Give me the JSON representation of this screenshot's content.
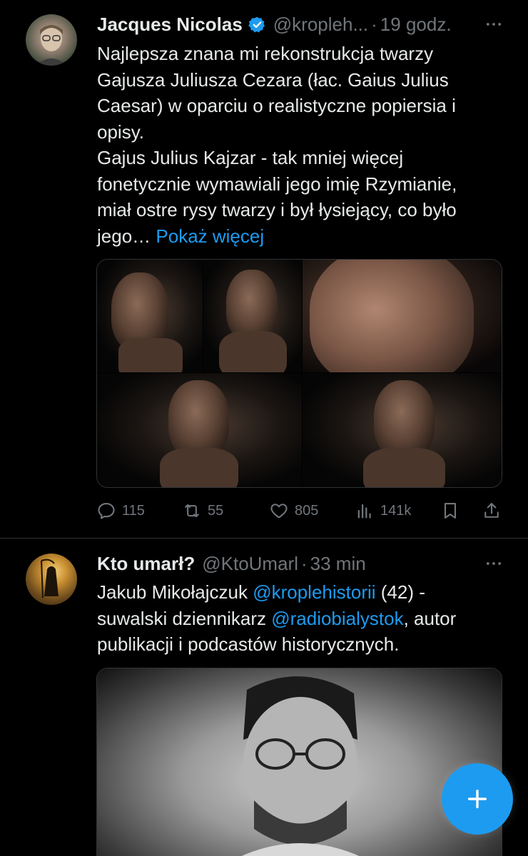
{
  "tweets": [
    {
      "author_name": "Jacques Nicolas",
      "handle": "@kropleh...",
      "separator": "·",
      "time": "19 godz.",
      "text_lines": [
        "Najlepsza  znana mi rekonstrukcja twarzy",
        "Gajusza Juliusza Cezara (łac. Gaius Julius",
        "Caesar) w oparciu o realistyczne popiersia i",
        "opisy.",
        "Gajus Julius Kajzar - tak mniej więcej",
        "fonetycznie wymawiali jego imię Rzymianie,",
        "miał ostre rysy twarzy i był łysiejący, co było",
        "jego…"
      ],
      "show_more": "Pokaż więcej",
      "stats": {
        "replies": "115",
        "retweets": "55",
        "likes": "805",
        "views": "141k"
      }
    },
    {
      "author_name": "Kto umarł?",
      "handle": "@KtoUmarl",
      "separator": "·",
      "time": "33 min",
      "text": {
        "line1_a": "Jakub Mikołajczuk ",
        "mention1": "@kroplehistorii",
        "line1_b": " (42) -",
        "line2_a": "suwalski dziennikarz ",
        "mention2": "@radiobialystok",
        "line2_b": ", autor",
        "line3": "publikacji i podcastów historycznych."
      }
    }
  ],
  "icons": {
    "verified": "verified-badge-icon",
    "more": "more-dots-icon",
    "reply": "reply-icon",
    "retweet": "retweet-icon",
    "like": "heart-icon",
    "views": "views-icon",
    "bookmark": "bookmark-icon",
    "share": "share-icon",
    "compose": "plus-icon"
  },
  "colors": {
    "background": "#000000",
    "text": "#e7e9ea",
    "muted": "#71767b",
    "accent": "#1d9bf0",
    "divider": "#2f3336"
  }
}
